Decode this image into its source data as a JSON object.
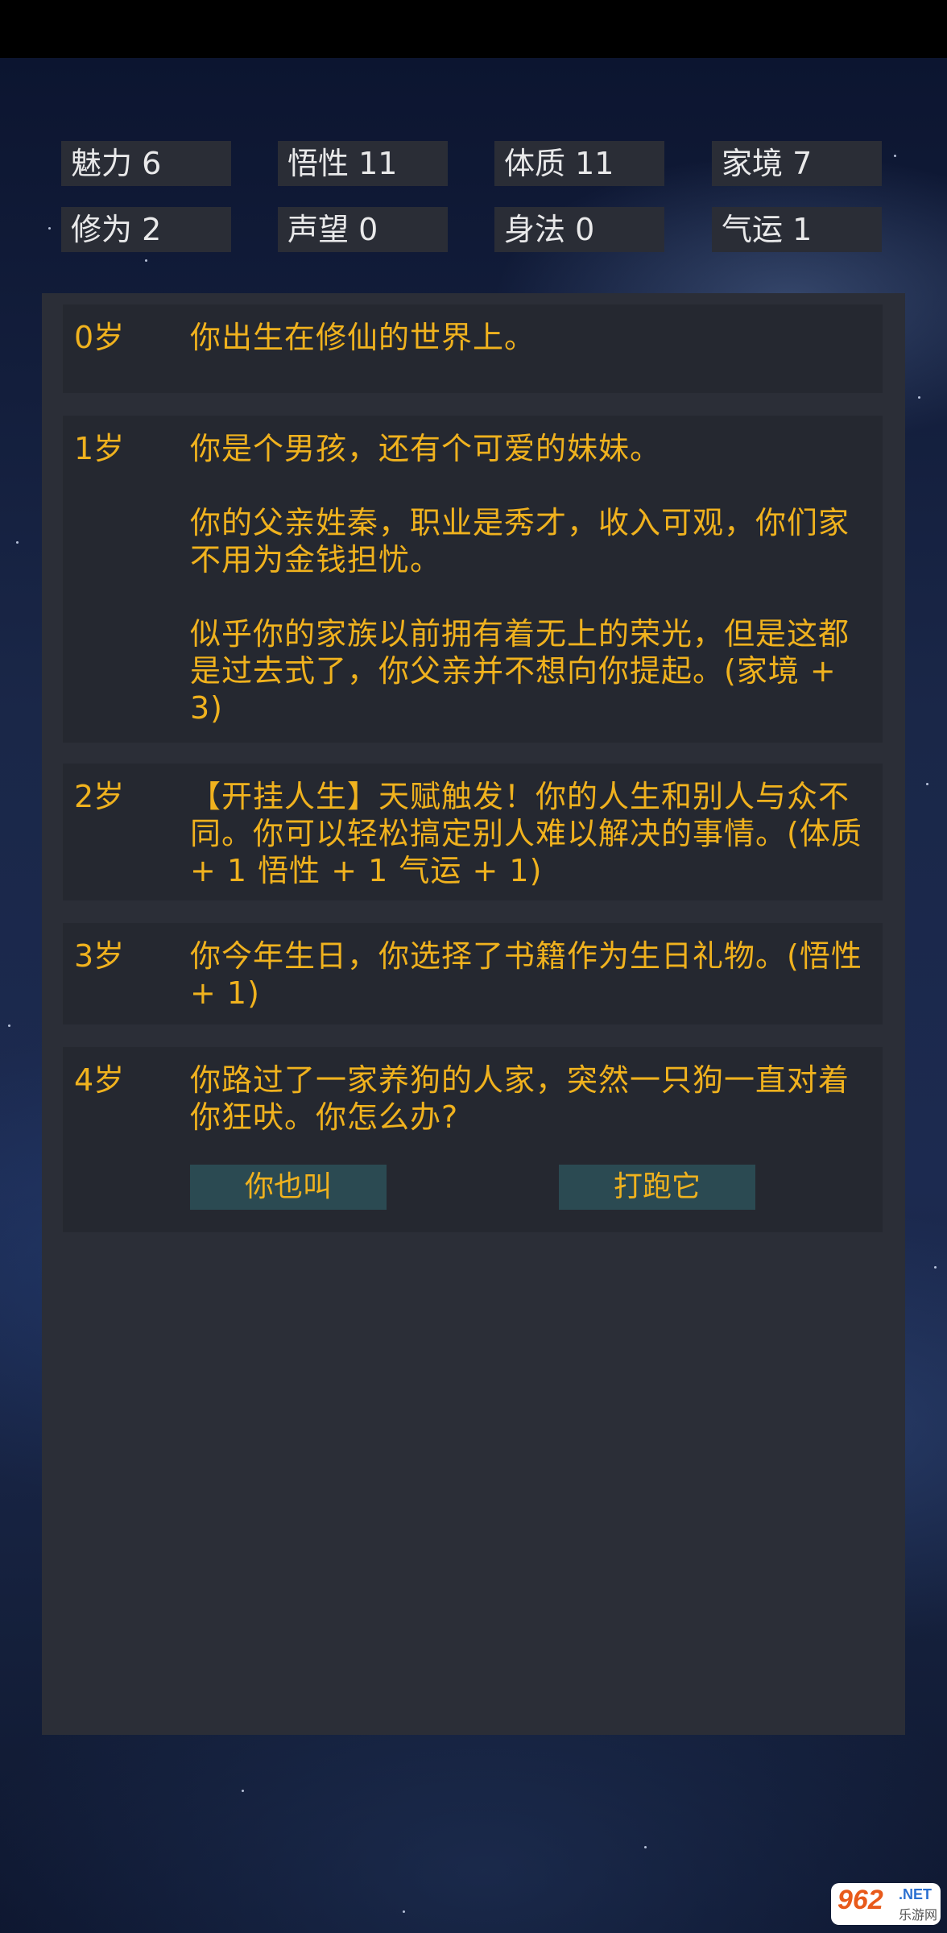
{
  "stats": [
    {
      "label": "魅力 6"
    },
    {
      "label": "悟性 11"
    },
    {
      "label": "体质 11"
    },
    {
      "label": "家境 7"
    },
    {
      "label": "修为 2"
    },
    {
      "label": "声望 0"
    },
    {
      "label": "身法 0"
    },
    {
      "label": "气运 1"
    }
  ],
  "events": [
    {
      "age": "0岁",
      "paragraphs": [
        "你出生在修仙的世界上。"
      ]
    },
    {
      "age": "1岁",
      "paragraphs": [
        "你是个男孩，还有个可爱的妹妹。",
        "你的父亲姓秦，职业是秀才，收入可观，你们家不用为金钱担忧。",
        "似乎你的家族以前拥有着无上的荣光，但是这都是过去式了，你父亲并不想向你提起。(家境 + 3)"
      ]
    },
    {
      "age": "2岁",
      "paragraphs": [
        "【开挂人生】天赋触发！你的人生和别人与众不同。你可以轻松搞定别人难以解决的事情。(体质 + 1 悟性 + 1 气运 + 1)"
      ]
    },
    {
      "age": "3岁",
      "paragraphs": [
        "你今年生日，你选择了书籍作为生日礼物。(悟性 + 1)"
      ]
    },
    {
      "age": "4岁",
      "paragraphs": [
        "你路过了一家养狗的人家，突然一只狗一直对着你狂吠。你怎么办?"
      ]
    }
  ],
  "choices": {
    "option1": "你也叫",
    "option2": "打跑它"
  },
  "watermark": {
    "number": "962",
    "net": ".NET",
    "cn": "乐游网"
  },
  "colors": {
    "event_text": "#f0b21e",
    "stat_box": "#2a2d36",
    "panel": "#2b2e37",
    "choice_button": "#2b4a52"
  }
}
